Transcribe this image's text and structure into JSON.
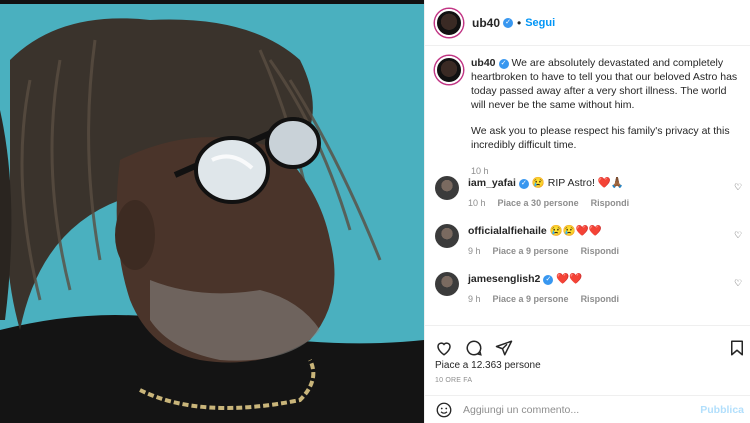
{
  "post": {
    "username": "ub40",
    "follow_label": "Segui",
    "separator": "•",
    "caption_p1": "We are absolutely devastated and completely heartbroken to have to tell you that our beloved Astro has today passed away after a very short illness. The world will never be the same without him.",
    "caption_p2": "We ask you to please respect his family's privacy at this incredibly difficult time.",
    "caption_time": "10 h"
  },
  "comments": [
    {
      "username": "iam_yafai",
      "text": "😢 RIP Astro! ❤️🙏🏾",
      "time": "10 h",
      "likes": "Piace a 30 persone",
      "reply": "Rispondi"
    },
    {
      "username": "officialalfiehaile",
      "text": "😢😢❤️❤️",
      "time": "9 h",
      "likes": "Piace a 9 persone",
      "reply": "Rispondi"
    },
    {
      "username": "jamesenglish2",
      "text": "❤️❤️",
      "time": "9 h",
      "likes": "Piace a 9 persone",
      "reply": "Rispondi"
    }
  ],
  "likes_text": "Piace a 12.363 persone",
  "date_text": "10 ORE FA",
  "add_comment": {
    "placeholder": "Aggiungi un commento...",
    "publish_label": "Pubblica"
  },
  "colors": {
    "link": "#0095f6",
    "muted": "#8e8e8e",
    "photo_bg": "#4fb0c0"
  },
  "icons": [
    "heart-icon",
    "comment-icon",
    "share-icon",
    "bookmark-icon",
    "emoji-icon",
    "verified-badge-icon"
  ]
}
